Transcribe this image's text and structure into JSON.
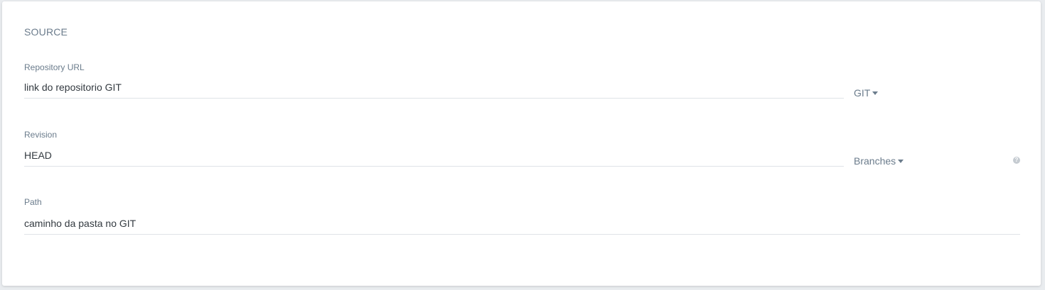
{
  "section": {
    "title": "SOURCE"
  },
  "fields": {
    "repository_url": {
      "label": "Repository URL",
      "value": "link do repositorio GIT",
      "type_dropdown": "GIT"
    },
    "revision": {
      "label": "Revision",
      "value": "HEAD",
      "ref_dropdown": "Branches",
      "help_icon": "help-icon"
    },
    "path": {
      "label": "Path",
      "value": "caminho da pasta no GIT"
    }
  },
  "colors": {
    "label": "#6b7c8c",
    "text": "#333a40",
    "underline": "#dfe3e7",
    "background": "#ffffff"
  }
}
